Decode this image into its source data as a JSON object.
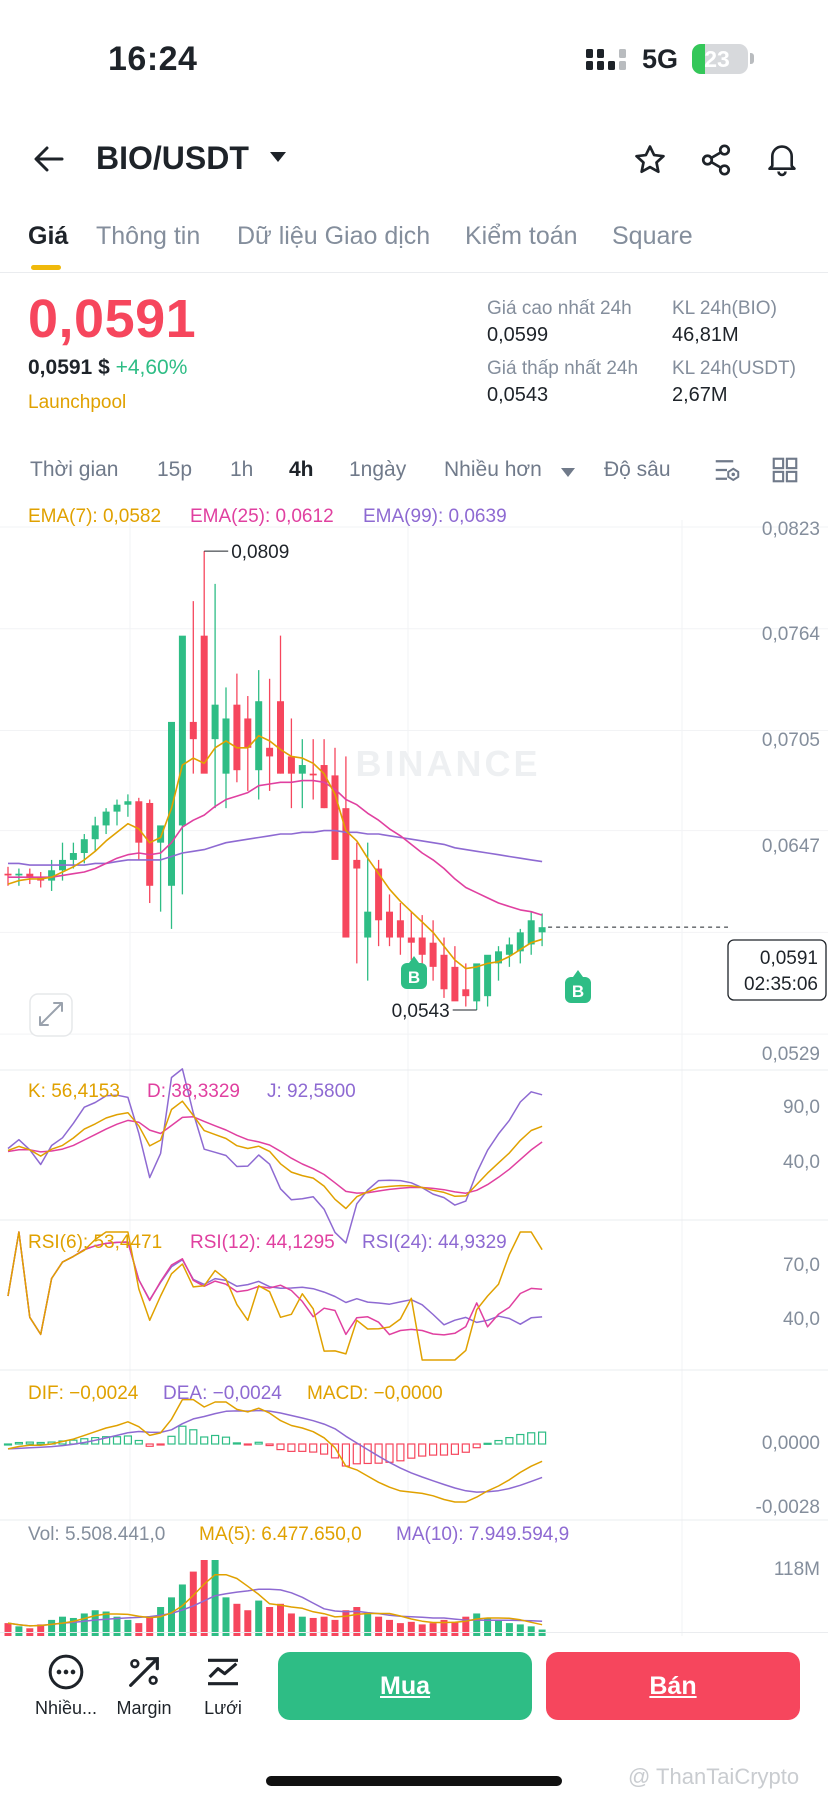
{
  "status_bar": {
    "time": "16:24",
    "network": "5G",
    "battery": "23",
    "battery_level": 0.23
  },
  "header": {
    "pair": "BIO/USDT"
  },
  "tabs": [
    "Giá",
    "Thông tin",
    "Dữ liệu Giao dịch",
    "Kiểm toán",
    "Square"
  ],
  "price": {
    "last": "0,0591",
    "fiat": "0,0591 $",
    "change": "+4,60%",
    "tag": "Launchpool",
    "high_label": "Giá cao nhất 24h",
    "high": "0,0599",
    "low_label": "Giá thấp nhất 24h",
    "low": "0,0543",
    "vol_base_label": "KL 24h(BIO)",
    "vol_base": "46,81M",
    "vol_quote_label": "KL 24h(USDT)",
    "vol_quote": "2,67M"
  },
  "timeframes": {
    "items": [
      "Thời gian",
      "15p",
      "1h",
      "4h",
      "1ngày"
    ],
    "active": "4h",
    "more": "Nhiều hơn",
    "depth": "Độ sâu"
  },
  "colors": {
    "up": "#2ebd85",
    "down": "#f6465d",
    "ema7": "#e0a100",
    "ema25": "#e040a0",
    "ema99": "#8e6ad2",
    "accent": "#f0b90b"
  },
  "main": {
    "ema_labels": [
      "EMA(7): 0,0582",
      "EMA(25): 0,0612",
      "EMA(99): 0,0639"
    ],
    "price_ticks": [
      "0,0823",
      "0,0764",
      "0,0705",
      "0,0647",
      "0,0529"
    ],
    "high_marker": "0,0809",
    "low_marker": "0,0543",
    "current_price": "0,0591",
    "countdown": "02:35:06",
    "watermark": "BINANCE",
    "buy_marker": "B"
  },
  "kdj": {
    "labels": [
      "K: 56,4153",
      "D: 38,3329",
      "J: 92,5800"
    ],
    "ticks": [
      "90,0",
      "40,0"
    ]
  },
  "rsi": {
    "labels": [
      "RSI(6): 53,4471",
      "RSI(12): 44,1295",
      "RSI(24): 44,9329"
    ],
    "ticks": [
      "70,0",
      "40,0"
    ]
  },
  "macd": {
    "labels": [
      "DIF: −0,0024",
      "DEA: −0,0024",
      "MACD: −0,0000"
    ],
    "ticks": [
      "0,0000",
      "-0,0028"
    ]
  },
  "vol": {
    "labels": [
      "Vol: 5.508.441,0",
      "MA(5): 6.477.650,0",
      "MA(10): 7.949.594,9"
    ],
    "ticks": [
      "118M"
    ]
  },
  "chart_data": {
    "type": "candlestick",
    "interval": "4h",
    "x": [
      1,
      2,
      3,
      4,
      5,
      6,
      7,
      8,
      9,
      10,
      11,
      12,
      13,
      14,
      15,
      16,
      17,
      18,
      19,
      20,
      21,
      22,
      23,
      24,
      25,
      26,
      27,
      28,
      29,
      30,
      31,
      32,
      33,
      34,
      35,
      36,
      37,
      38,
      39,
      40,
      41,
      42,
      43,
      44,
      45,
      46,
      47,
      48,
      49,
      50
    ],
    "open": [
      0.0622,
      0.0621,
      0.0622,
      0.062,
      0.0618,
      0.0624,
      0.063,
      0.0634,
      0.0642,
      0.065,
      0.0658,
      0.0662,
      0.0664,
      0.0663,
      0.064,
      0.0615,
      0.065,
      0.071,
      0.076,
      0.07,
      0.068,
      0.072,
      0.0712,
      0.0682,
      0.0695,
      0.0722,
      0.069,
      0.068,
      0.068,
      0.0685,
      0.0679,
      0.066,
      0.063,
      0.0585,
      0.0625,
      0.06,
      0.0595,
      0.0585,
      0.0585,
      0.0582,
      0.0575,
      0.0568,
      0.0555,
      0.0548,
      0.0551,
      0.057,
      0.0575,
      0.0577,
      0.0581,
      0.0588
    ],
    "high": [
      0.0626,
      0.0625,
      0.0625,
      0.0623,
      0.063,
      0.064,
      0.064,
      0.0645,
      0.0655,
      0.066,
      0.0665,
      0.0668,
      0.0666,
      0.0665,
      0.0645,
      0.066,
      0.0735,
      0.078,
      0.0809,
      0.079,
      0.073,
      0.0738,
      0.0725,
      0.074,
      0.0735,
      0.076,
      0.0712,
      0.07,
      0.07,
      0.07,
      0.0695,
      0.069,
      0.064,
      0.064,
      0.063,
      0.061,
      0.0605,
      0.06,
      0.0598,
      0.0595,
      0.0585,
      0.058,
      0.057,
      0.0562,
      0.0565,
      0.058,
      0.0585,
      0.059,
      0.06,
      0.0599
    ],
    "low": [
      0.0615,
      0.0615,
      0.0616,
      0.0614,
      0.0612,
      0.0618,
      0.0625,
      0.0628,
      0.0635,
      0.0645,
      0.065,
      0.0655,
      0.063,
      0.0605,
      0.06,
      0.059,
      0.061,
      0.068,
      0.069,
      0.066,
      0.066,
      0.0675,
      0.067,
      0.0665,
      0.067,
      0.068,
      0.066,
      0.066,
      0.0665,
      0.066,
      0.0655,
      0.062,
      0.057,
      0.056,
      0.058,
      0.058,
      0.0575,
      0.0572,
      0.057,
      0.056,
      0.055,
      0.0555,
      0.0545,
      0.0543,
      0.0545,
      0.056,
      0.0568,
      0.057,
      0.0575,
      0.058
    ],
    "close": [
      0.0621,
      0.0622,
      0.062,
      0.0618,
      0.0624,
      0.063,
      0.0634,
      0.0642,
      0.065,
      0.0658,
      0.0662,
      0.0664,
      0.064,
      0.0615,
      0.065,
      0.071,
      0.076,
      0.07,
      0.068,
      0.072,
      0.0712,
      0.0682,
      0.0695,
      0.0722,
      0.069,
      0.068,
      0.068,
      0.0685,
      0.0679,
      0.066,
      0.063,
      0.0585,
      0.0625,
      0.06,
      0.0595,
      0.0585,
      0.0585,
      0.0582,
      0.0575,
      0.0568,
      0.0555,
      0.0548,
      0.0551,
      0.057,
      0.0575,
      0.0577,
      0.0581,
      0.0588,
      0.0595,
      0.0591
    ],
    "ylim": [
      0.0514,
      0.0823
    ],
    "ema7": [
      0.0616,
      0.0618,
      0.0619,
      0.0619,
      0.062,
      0.0623,
      0.0626,
      0.063,
      0.0635,
      0.0641,
      0.0646,
      0.0651,
      0.0648,
      0.064,
      0.0643,
      0.066,
      0.0685,
      0.0689,
      0.0686,
      0.0695,
      0.0699,
      0.0695,
      0.0695,
      0.0702,
      0.0699,
      0.0694,
      0.069,
      0.0689,
      0.0686,
      0.068,
      0.0668,
      0.0647,
      0.0641,
      0.0631,
      0.0622,
      0.0613,
      0.0606,
      0.06,
      0.0594,
      0.0588,
      0.058,
      0.0572,
      0.0567,
      0.0568,
      0.057,
      0.0571,
      0.0574,
      0.0578,
      0.0582,
      0.0584
    ],
    "ema25": [
      0.062,
      0.062,
      0.062,
      0.062,
      0.062,
      0.0621,
      0.0622,
      0.0623,
      0.0625,
      0.0628,
      0.0631,
      0.0633,
      0.0634,
      0.0633,
      0.0634,
      0.064,
      0.0649,
      0.0653,
      0.0656,
      0.0661,
      0.0665,
      0.0667,
      0.0669,
      0.0673,
      0.0674,
      0.0675,
      0.0675,
      0.0676,
      0.0676,
      0.0675,
      0.0671,
      0.0665,
      0.0662,
      0.0657,
      0.0653,
      0.0648,
      0.0644,
      0.0639,
      0.0634,
      0.063,
      0.0625,
      0.0619,
      0.0614,
      0.0611,
      0.0608,
      0.0605,
      0.0603,
      0.0601,
      0.06,
      0.0598
    ],
    "ema99": [
      0.0628,
      0.0628,
      0.0627,
      0.0627,
      0.0627,
      0.0627,
      0.0627,
      0.0627,
      0.0628,
      0.0628,
      0.0629,
      0.063,
      0.063,
      0.063,
      0.063,
      0.0632,
      0.0634,
      0.0635,
      0.0636,
      0.0638,
      0.064,
      0.0641,
      0.0642,
      0.0643,
      0.0644,
      0.0645,
      0.0645,
      0.0646,
      0.0646,
      0.0647,
      0.0647,
      0.0646,
      0.0646,
      0.0645,
      0.0645,
      0.0644,
      0.0643,
      0.0642,
      0.0641,
      0.064,
      0.0639,
      0.0637,
      0.0636,
      0.0635,
      0.0634,
      0.0633,
      0.0632,
      0.0631,
      0.063,
      0.0629
    ],
    "volume": [
      20,
      15,
      12,
      18,
      25,
      30,
      28,
      35,
      40,
      38,
      30,
      25,
      20,
      30,
      45,
      60,
      80,
      100,
      118,
      118,
      60,
      50,
      40,
      55,
      45,
      50,
      35,
      30,
      28,
      30,
      25,
      40,
      45,
      35,
      30,
      25,
      20,
      22,
      18,
      20,
      25,
      22,
      30,
      35,
      28,
      25,
      20,
      18,
      15,
      10
    ],
    "annotations": [
      "0,0809",
      "0,0543"
    ]
  }
}
